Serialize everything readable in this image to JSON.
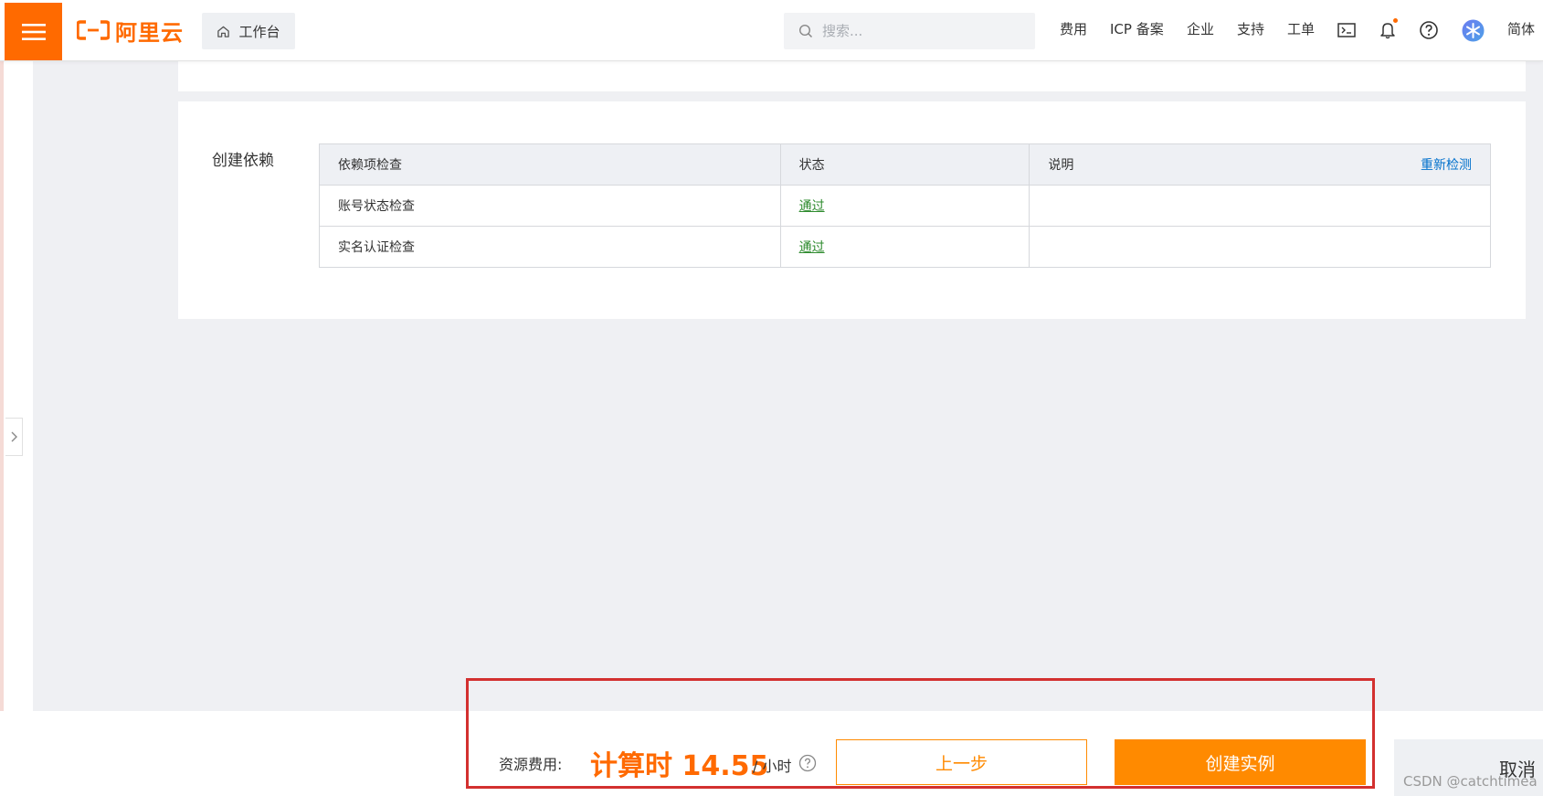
{
  "header": {
    "brand": "阿里云",
    "workbench_label": "工作台",
    "search_placeholder": "搜索...",
    "nav": {
      "fees": "费用",
      "icp": "ICP 备案",
      "enterprise": "企业",
      "support": "支持",
      "tickets": "工单"
    },
    "lang": "简体",
    "icons": [
      "menu-icon",
      "home-icon",
      "search-icon",
      "terminal-icon",
      "bell-icon",
      "help-circle-icon",
      "avatar-icon"
    ]
  },
  "dependencies": {
    "section_label": "创建依赖",
    "columns": {
      "check": "依赖项检查",
      "status": "状态",
      "description": "说明"
    },
    "recheck_label": "重新检测",
    "rows": [
      {
        "check": "账号状态检查",
        "status": "通过",
        "description": ""
      },
      {
        "check": "实名认证检查",
        "status": "通过",
        "description": ""
      }
    ]
  },
  "footer": {
    "fee_label": "资源费用:",
    "fee_amount": "计算时 14.55",
    "fee_unit": "/ 小时",
    "prev_label": "上一步",
    "create_label": "创建实例",
    "cancel_label": "取消"
  },
  "watermark": "CSDN @catchtimea",
  "colors": {
    "brand": "#ff6a00",
    "primary_button": "#ff8a00",
    "link": "#0070cc",
    "pass": "#2e8b2e",
    "highlight_box": "#d3302f",
    "page_bg": "#eff0f3"
  }
}
